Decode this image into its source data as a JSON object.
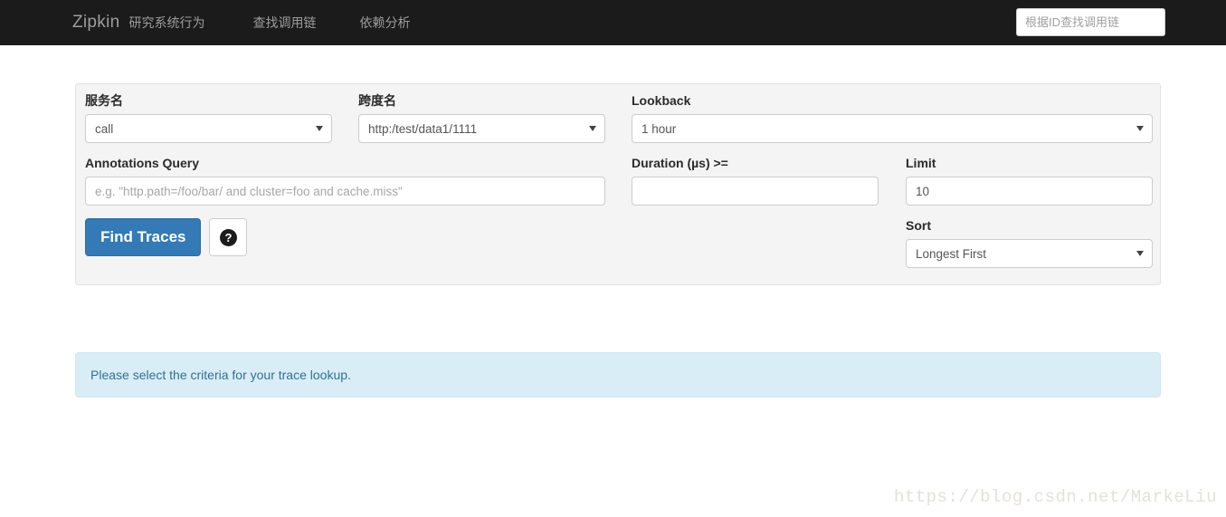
{
  "navbar": {
    "brand": "Zipkin",
    "brand_sub": "研究系统行为",
    "links": [
      {
        "label": "查找调用链"
      },
      {
        "label": "依赖分析"
      }
    ],
    "search_placeholder": "根据ID查找调用链",
    "search_value": "",
    "bg_color": "#1b1b1b",
    "text_color": "#9d9d9d"
  },
  "search_form": {
    "service_name": {
      "label": "服务名",
      "value": "call"
    },
    "span_name": {
      "label": "跨度名",
      "value": "http:/test/data1/1111"
    },
    "lookback": {
      "label": "Lookback",
      "value": "1 hour"
    },
    "annotations_query": {
      "label": "Annotations Query",
      "value": "",
      "placeholder": "e.g. \"http.path=/foo/bar/ and cluster=foo and cache.miss\""
    },
    "duration": {
      "label": "Duration (µs) >=",
      "value": "",
      "placeholder": ""
    },
    "limit": {
      "label": "Limit",
      "value": "10"
    },
    "sort": {
      "label": "Sort",
      "value": "Longest First"
    },
    "find_traces_button": "Find Traces",
    "help_button_glyph": "?",
    "primary_color": "#337ab7",
    "panel_bg": "#f4f4f4"
  },
  "alert": {
    "message": "Please select the criteria for your trace lookup.",
    "bg_color": "#d9edf7",
    "text_color": "#31708f"
  },
  "watermark": {
    "text": "https://blog.csdn.net/MarkeLiu"
  }
}
